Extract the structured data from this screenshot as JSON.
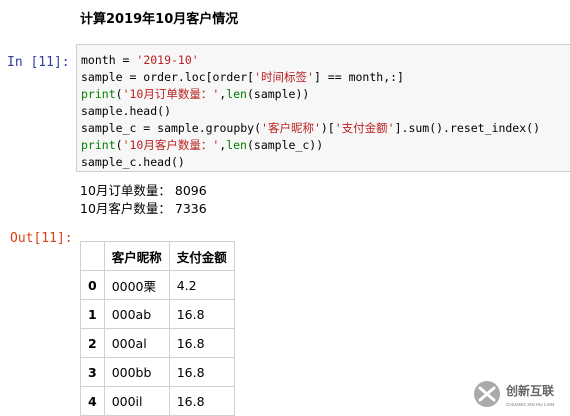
{
  "heading": "计算2019年10月客户情况",
  "input_prompt": "In  [11]:",
  "output_prompt": "Out[11]:",
  "code_lines": [
    [
      {
        "t": "month = ",
        "c": ""
      },
      {
        "t": "'2019-10'",
        "c": "str"
      }
    ],
    [
      {
        "t": "sample = order.loc[order[",
        "c": ""
      },
      {
        "t": "'时间标签'",
        "c": "str"
      },
      {
        "t": "] == month,:]",
        "c": ""
      }
    ],
    [
      {
        "t": "print",
        "c": "kw"
      },
      {
        "t": "(",
        "c": ""
      },
      {
        "t": "'10月订单数量：'",
        "c": "str"
      },
      {
        "t": ",",
        "c": ""
      },
      {
        "t": "len",
        "c": "kw"
      },
      {
        "t": "(sample))",
        "c": ""
      }
    ],
    [
      {
        "t": "sample.head()",
        "c": ""
      }
    ],
    [
      {
        "t": "sample_c = sample.groupby(",
        "c": ""
      },
      {
        "t": "'客户昵称'",
        "c": "str"
      },
      {
        "t": ")[",
        "c": ""
      },
      {
        "t": "'支付金额'",
        "c": "str"
      },
      {
        "t": "].sum().reset_index()",
        "c": ""
      }
    ],
    [
      {
        "t": "print",
        "c": "kw"
      },
      {
        "t": "(",
        "c": ""
      },
      {
        "t": "'10月客户数量：'",
        "c": "str"
      },
      {
        "t": ",",
        "c": ""
      },
      {
        "t": "len",
        "c": "kw"
      },
      {
        "t": "(sample_c))",
        "c": ""
      }
    ],
    [
      {
        "t": "sample_c.head()",
        "c": ""
      }
    ]
  ],
  "stdout": [
    "10月订单数量： 8096",
    "10月客户数量： 7336"
  ],
  "table": {
    "columns": [
      "",
      "客户昵称",
      "支付金额"
    ],
    "rows": [
      [
        "0",
        "0000栗",
        "4.2"
      ],
      [
        "1",
        "000ab",
        "16.8"
      ],
      [
        "2",
        "000al",
        "16.8"
      ],
      [
        "3",
        "000bb",
        "16.8"
      ],
      [
        "4",
        "000il",
        "16.8"
      ]
    ]
  },
  "watermark": {
    "brand": "创新互联",
    "sub": "CHUANG XIN HU LIAN",
    "color": "#666666"
  }
}
